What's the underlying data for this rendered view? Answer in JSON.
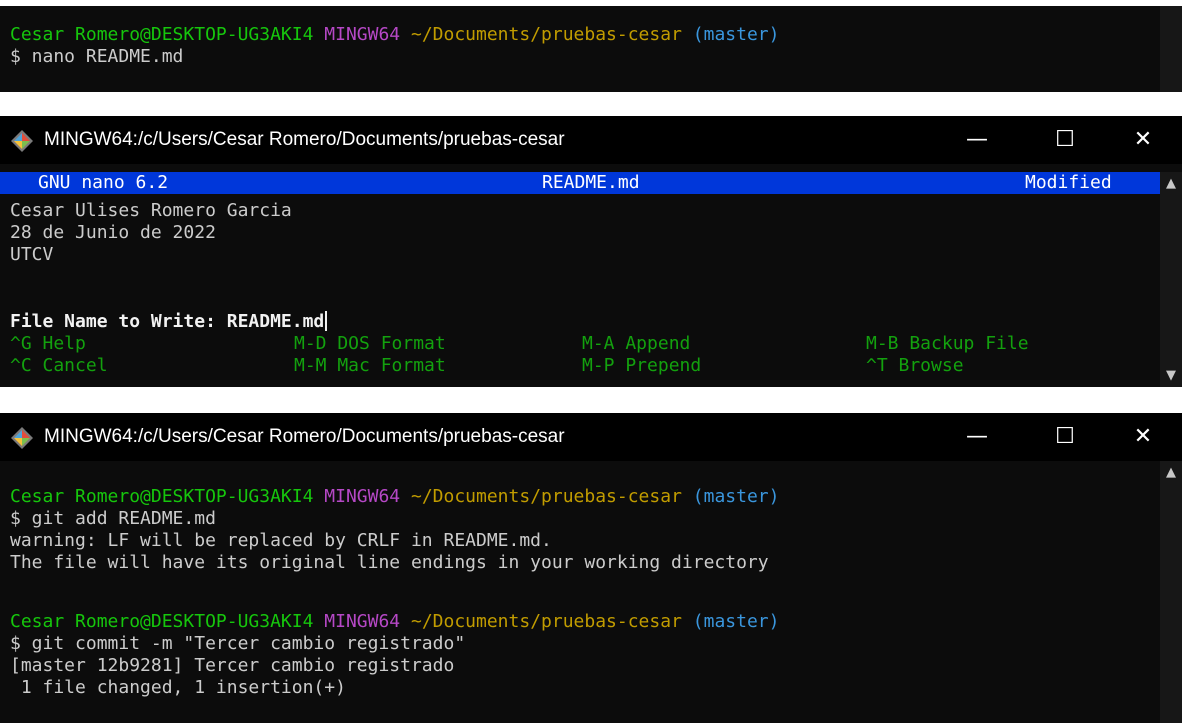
{
  "panel1": {
    "prompt": {
      "user": "Cesar Romero@DESKTOP-UG3AKI4",
      "env": "MINGW64",
      "path": "~/Documents/pruebas-cesar",
      "branch": "(master)"
    },
    "command": "$ nano README.md"
  },
  "panel2": {
    "window_title": "MINGW64:/c/Users/Cesar Romero/Documents/pruebas-cesar",
    "nano_header": {
      "version": "GNU nano 6.2",
      "filename": "README.md",
      "status": "Modified"
    },
    "content": [
      "Cesar Ulises Romero Garcia",
      "28 de Junio de 2022",
      "UTCV"
    ],
    "write_prompt": "File Name to Write: README.md",
    "shortcuts_row1": [
      "^G Help",
      "M-D DOS Format",
      "M-A Append",
      "M-B Backup File"
    ],
    "shortcuts_row2": [
      "^C Cancel",
      "M-M Mac Format",
      "M-P Prepend",
      "^T Browse"
    ]
  },
  "panel3": {
    "window_title": "MINGW64:/c/Users/Cesar Romero/Documents/pruebas-cesar",
    "prompt": {
      "user": "Cesar Romero@DESKTOP-UG3AKI4",
      "env": "MINGW64",
      "path": "~/Documents/pruebas-cesar",
      "branch": "(master)"
    },
    "cmd1": "$ git add README.md",
    "out1": "warning: LF will be replaced by CRLF in README.md.",
    "out2": "The file will have its original line endings in your working directory",
    "cmd2": "$ git commit -m \"Tercer cambio registrado\"",
    "out3": "[master 12b9281] Tercer cambio registrado",
    "out4": " 1 file changed, 1 insertion(+)"
  },
  "window_controls": {
    "minimize": "—",
    "maximize": "☐",
    "close": "✕"
  },
  "icons": {
    "app": "git-bash-icon",
    "scroll_up": "chevron-up-icon",
    "scroll_down": "chevron-down-icon"
  },
  "colors": {
    "background": "#0c0c0c",
    "nano_bar": "#0037da",
    "prompt_user": "#16c60c",
    "prompt_env": "#b648c6",
    "prompt_path": "#c19c00",
    "prompt_branch": "#3a96dd",
    "shortcut": "#13a10e"
  }
}
